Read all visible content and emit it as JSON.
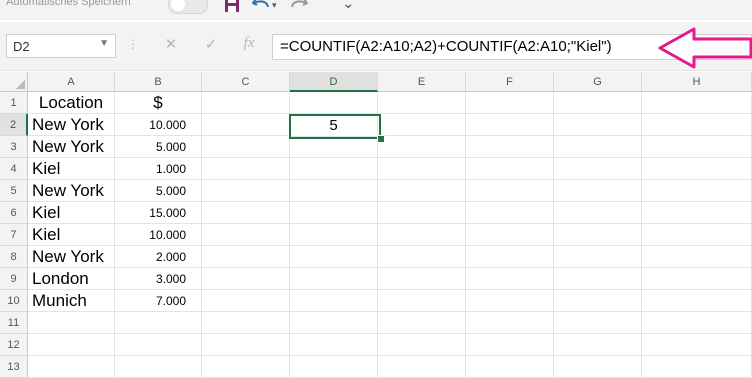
{
  "titlebar": {
    "autosave_label": "Automatisches Speichern",
    "icons": [
      "toggle-switch",
      "save-icon",
      "undo-icon",
      "dropdown-icon",
      "redo-icon",
      "more-icon"
    ]
  },
  "formula_bar": {
    "name_box": "D2",
    "formula": "=COUNTIF(A2:A10;A2)+COUNTIF(A2:A10;\"Kiel\")",
    "cancel_icon": "✕",
    "enter_icon": "✓",
    "fx_icon": "fx"
  },
  "annotation": {
    "arrow_color": "#e6198a"
  },
  "colors": {
    "accent": "#217346"
  },
  "columns": [
    "A",
    "B",
    "C",
    "D",
    "E",
    "F",
    "G",
    "H"
  ],
  "rows": [
    "1",
    "2",
    "3",
    "4",
    "5",
    "6",
    "7",
    "8",
    "9",
    "10",
    "11",
    "12",
    "13"
  ],
  "selected": {
    "cell": "D2",
    "column": "D",
    "row": "2"
  },
  "table": {
    "header": {
      "location": "Location",
      "amount": "$"
    },
    "records": [
      {
        "location": "New York",
        "amount": "10.000"
      },
      {
        "location": "New York",
        "amount": "5.000"
      },
      {
        "location": "Kiel",
        "amount": "1.000"
      },
      {
        "location": "New York",
        "amount": "5.000"
      },
      {
        "location": "Kiel",
        "amount": "15.000"
      },
      {
        "location": "Kiel",
        "amount": "10.000"
      },
      {
        "location": "New York",
        "amount": "2.000"
      },
      {
        "location": "London",
        "amount": "3.000"
      },
      {
        "location": "Munich",
        "amount": "7.000"
      }
    ]
  },
  "result_cell": {
    "address": "D2",
    "value": "5"
  }
}
